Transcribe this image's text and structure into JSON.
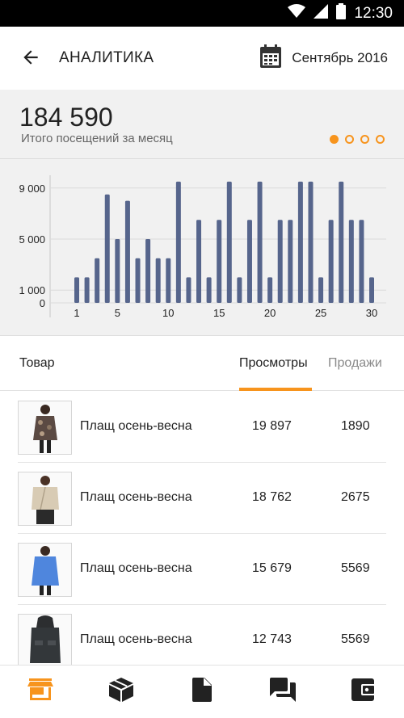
{
  "status_bar": {
    "time": "12:30",
    "icons": [
      "wifi-icon",
      "signal-icon",
      "battery-icon"
    ]
  },
  "app_bar": {
    "title": "АНАЛИТИКА",
    "back_icon": "arrow-back-icon",
    "date_icon": "calendar-icon",
    "date_label": "Сентябрь 2016"
  },
  "summary": {
    "value": "184 590",
    "label": "Итого посещений за месяц",
    "pager_total": 4,
    "pager_active_index": 0
  },
  "chart_data": {
    "type": "bar",
    "x": [
      1,
      2,
      3,
      4,
      5,
      6,
      7,
      8,
      9,
      10,
      11,
      12,
      13,
      14,
      15,
      16,
      17,
      18,
      19,
      20,
      21,
      22,
      23,
      24,
      25,
      26,
      27,
      28,
      29,
      30
    ],
    "series": [
      {
        "values": [
          2000,
          2000,
          3500,
          8500,
          5000,
          8000,
          3500,
          5000,
          3500,
          3500,
          9500,
          2000,
          6500,
          2000,
          6500,
          9500,
          2000,
          6500,
          9500,
          2000,
          6500,
          6500,
          9500,
          9500,
          2000,
          6500,
          9500,
          6500,
          6500,
          2000
        ]
      }
    ],
    "y_tick_labels": [
      "9 000",
      "5 000",
      "1 000",
      "0"
    ],
    "x_tick_labels": [
      "1",
      "5",
      "10",
      "15",
      "20",
      "25",
      "30"
    ],
    "x_tick_values": [
      1,
      5,
      10,
      15,
      20,
      25,
      30
    ],
    "ylim": [
      0,
      10000
    ],
    "grid": true,
    "bar_color": "#56658c"
  },
  "table": {
    "header": {
      "product": "Товар",
      "views_tab": "Просмотры",
      "sales_tab": "Продажи",
      "active_tab": "views"
    },
    "rows": [
      {
        "name": "Плащ осень-весна",
        "views": "19 897",
        "sales": "1890",
        "thumb": "coat-floral-image"
      },
      {
        "name": "Плащ осень-весна",
        "views": "18 762",
        "sales": "2675",
        "thumb": "jacket-beige-image"
      },
      {
        "name": "Плащ осень-весна",
        "views": "15 679",
        "sales": "5569",
        "thumb": "coat-blue-image"
      },
      {
        "name": "Плащ осень-весна",
        "views": "12 743",
        "sales": "5569",
        "thumb": "parka-dark-image"
      }
    ]
  },
  "bottom_nav": {
    "items": [
      "store-icon",
      "package-icon",
      "document-icon",
      "chat-icon",
      "wallet-icon"
    ],
    "active_index": 0
  },
  "colors": {
    "accent": "#f7941d",
    "bar": "#56658c",
    "nav_inactive": "#222222"
  }
}
